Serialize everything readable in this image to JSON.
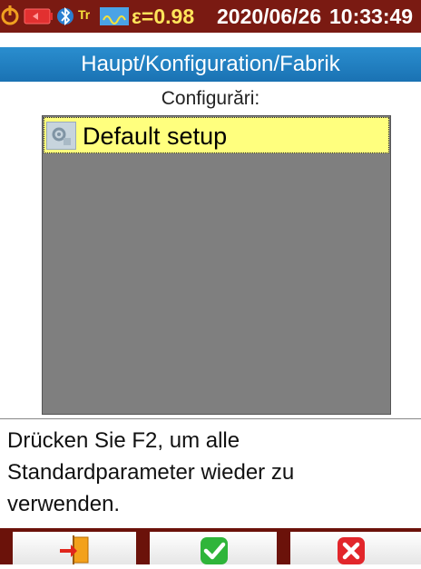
{
  "status": {
    "epsilon": "ε=0.98",
    "date": "2020/06/26",
    "time": "10:33:49",
    "tf_label": "Tr",
    "icons": [
      "power-icon",
      "battery-icon",
      "bluetooth-icon",
      "tf-icon",
      "keyboard-icon"
    ]
  },
  "title": "Haupt/Konfiguration/Fabrik",
  "list": {
    "caption": "Configurări:",
    "items": [
      {
        "label": "Default setup",
        "icon": "settings-file-icon",
        "selected": true
      }
    ]
  },
  "help": {
    "text": "Drücken Sie F2, um alle Standardparameter wieder zu verwenden."
  },
  "function_keys": [
    {
      "icon": "exit-icon"
    },
    {
      "icon": "confirm-check-icon"
    },
    {
      "icon": "cancel-x-icon"
    }
  ],
  "colors": {
    "status_bg": "#7a1a12",
    "status_text": "#ffe45a",
    "title_bg": "#2a8ecf",
    "list_bg": "#7f7f7f",
    "selection": "#ffff7e",
    "ok_green": "#2fb53a",
    "cancel_red": "#e2262b"
  }
}
